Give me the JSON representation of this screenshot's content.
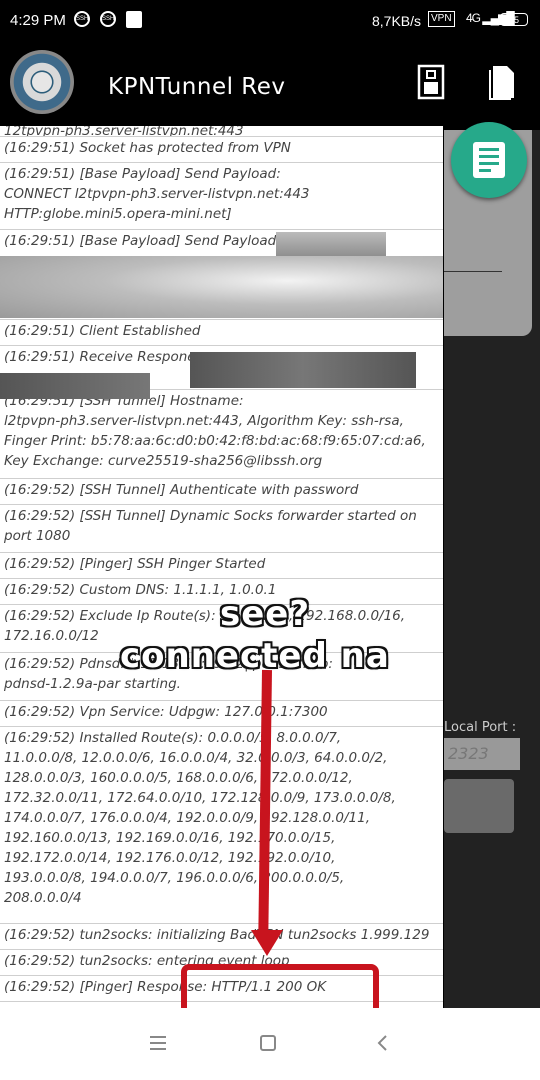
{
  "status_bar": {
    "time": "4:29 PM",
    "notification_icons": [
      "ssh-icon",
      "ssh-icon",
      "message-icon"
    ],
    "network_speed": "8,7KB/s",
    "vpn_badge": "VPN",
    "signal": "4G signal",
    "battery": "65"
  },
  "app_bar": {
    "title": "KPNTunnel Rev",
    "actions": [
      "clear-log-icon",
      "document-icon"
    ]
  },
  "log_entries": [
    "12tpvpn-ph3.server-listvpn.net:443",
    "(16:29:51) Socket has protected from VPN",
    "(16:29:51) [Base Payload] Send Payload:\nCONNECT l2tpvpn-ph3.server-listvpn.net:443\nHTTP:globe.mini5.opera-mini.net]",
    "(16:29:51) [Base Payload] Send Payload:",
    "(16:29:51) Client Established",
    "(16:29:51) Receive Respone",
    "(16:29:51) [SSH Tunnel] Hostname:\nl2tpvpn-ph3.server-listvpn.net:443, Algorithm Key: ssh-rsa,\nFinger Print: b5:78:aa:6c:d0:b0:42:f8:bd:ac:68:f9:65:07:cd:a6,\nKey Exchange: curve25519-sha256@libssh.org",
    "(16:29:52) [SSH Tunnel] Authenticate with password",
    "(16:29:52) [SSH Tunnel] Dynamic Socks forwarder started on\nport 1080",
    "(16:29:52) [Pinger] SSH Pinger Started",
    "(16:29:52) Custom DNS: 1.1.1.1, 1.0.0.1",
    "(16:29:52) Exclude Ip Route(s): 10.0.0.0/8, 192.168.0.0/16,\n172.16.0.0/12",
    "(16:29:52) Pdnsd: * 11/13 16:29:52| pdnsd: info:\npdnsd-1.2.9a-par starting.",
    "(16:29:52) Vpn Service: Udpgw: 127.0.0.1:7300",
    "(16:29:52) Installed Route(s): 0.0.0.0/5, 8.0.0.0/7,\n11.0.0.0/8, 12.0.0.0/6, 16.0.0.0/4, 32.0.0.0/3, 64.0.0.0/2,\n128.0.0.0/3, 160.0.0.0/5, 168.0.0.0/6, 172.0.0.0/12,\n172.32.0.0/11, 172.64.0.0/10, 172.128.0.0/9, 173.0.0.0/8,\n174.0.0.0/7, 176.0.0.0/4, 192.0.0.0/9, 192.128.0.0/11,\n192.160.0.0/13, 192.169.0.0/16, 192.170.0.0/15,\n192.172.0.0/14, 192.176.0.0/12, 192.192.0.0/10,\n193.0.0.0/8, 194.0.0.0/7, 196.0.0.0/6, 200.0.0.0/5,\n208.0.0.0/4",
    "(16:29:52) tun2socks: initializing BadVPN tun2socks 1.999.129",
    "(16:29:52) tun2socks: entering event loop",
    "(16:29:52) [Pinger] Response: HTTP/1.1 200 OK"
  ],
  "right_panel": {
    "local_port_label": "Local Port :",
    "local_port_value": "2323"
  },
  "annotation": {
    "line1": "see?",
    "line2": "connected na"
  },
  "colors": {
    "accent": "#26a98a",
    "annotation_red": "#c8141e"
  }
}
